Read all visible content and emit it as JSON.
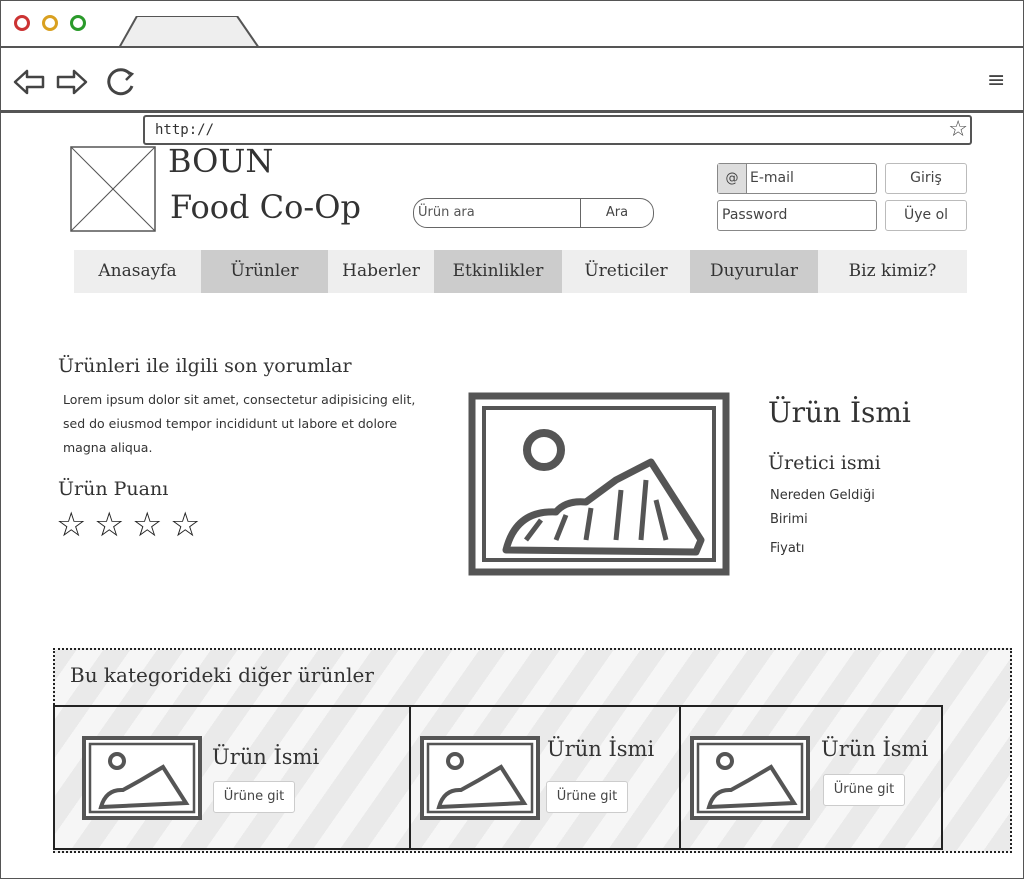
{
  "browser": {
    "url": "http://",
    "traffic_lights": {
      "red": "#cc3333",
      "yellow": "#d9a020",
      "green": "#2a9a2a"
    }
  },
  "header": {
    "site_title_line1": "BOUN",
    "site_title_line2": "Food Co-Op",
    "search_placeholder": "Ürün ara",
    "search_button": "Ara",
    "email_prefix": "@",
    "email_placeholder": "E-mail",
    "password_placeholder": "Password",
    "login_button": "Giriş",
    "signup_button": "Üye ol"
  },
  "nav": {
    "items": [
      {
        "label": "Anasayfa"
      },
      {
        "label": "Ürünler"
      },
      {
        "label": "Haberler"
      },
      {
        "label": "Etkinlikler"
      },
      {
        "label": "Üreticiler"
      },
      {
        "label": "Duyurular"
      },
      {
        "label": "Biz kimiz?"
      }
    ]
  },
  "main": {
    "comments_heading": "Ürünleri ile ilgili son yorumlar",
    "comments_text": "Lorem ipsum dolor sit amet, consectetur adipisicing elit, sed do eiusmod tempor incididunt ut labore et dolore magna aliqua.",
    "rating_heading": "Ürün Puanı",
    "rating_stars": 4,
    "product_name": "Ürün İsmi",
    "producer_name": "Üretici ismi",
    "origin": "Nereden Geldiği",
    "unit": "Birimi",
    "price": "Fiyatı"
  },
  "related": {
    "heading": "Bu kategorideki diğer ürünler",
    "cards": [
      {
        "title": "Ürün İsmi",
        "button": "Ürüne git"
      },
      {
        "title": "Ürün İsmi",
        "button": "Ürüne git"
      },
      {
        "title": "Ürün İsmi",
        "button": "Ürüne git"
      }
    ]
  }
}
